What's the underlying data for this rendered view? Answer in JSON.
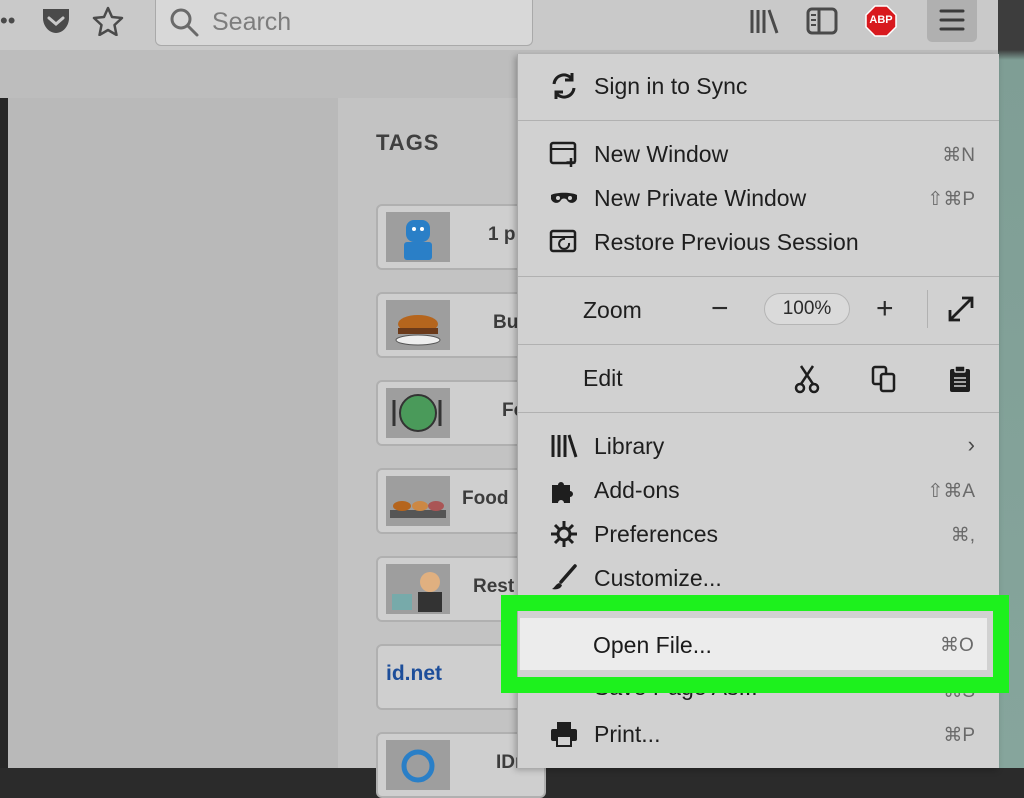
{
  "toolbar": {
    "search_placeholder": "Search",
    "abp_label": "ABP",
    "overflow_glyph": "••",
    "pocket_icon": "pocket-icon",
    "bookmark_icon": "star-icon",
    "library_icon": "library-icon",
    "sidebar_icon": "sidebar-icon",
    "menu_icon": "hamburger-icon",
    "accent_highlight": "#1df11d",
    "abp_color": "#d8191e"
  },
  "page": {
    "tags_heading": "TAGS",
    "cards": [
      {
        "label": "1 p",
        "icon": "person-icon"
      },
      {
        "label": "Bu",
        "icon": "burger-icon"
      },
      {
        "label": "Fo",
        "icon": "plate-icon"
      },
      {
        "label": "Food",
        "icon": "food-icon"
      },
      {
        "label": "Rest",
        "icon": "restaurant-icon"
      },
      {
        "label": "id.net",
        "icon": "idnet-icon"
      },
      {
        "label": "IDna",
        "icon": "refresh-icon"
      }
    ]
  },
  "menu": {
    "sign_in": "Sign in to Sync",
    "new_window": "New Window",
    "new_window_sc": "⌘N",
    "private_window": "New Private Window",
    "private_window_sc": "⇧⌘P",
    "restore": "Restore Previous Session",
    "zoom_label": "Zoom",
    "zoom_value": "100%",
    "zoom_minus": "−",
    "zoom_plus": "+",
    "edit_label": "Edit",
    "library": "Library",
    "addons": "Add-ons",
    "addons_sc": "⇧⌘A",
    "preferences": "Preferences",
    "preferences_sc": "⌘,",
    "customize": "Customize...",
    "open_file": "Open File...",
    "open_file_sc": "⌘O",
    "save_page": "Save Page As...",
    "save_page_sc": "⌘S",
    "print": "Print...",
    "print_sc": "⌘P"
  }
}
